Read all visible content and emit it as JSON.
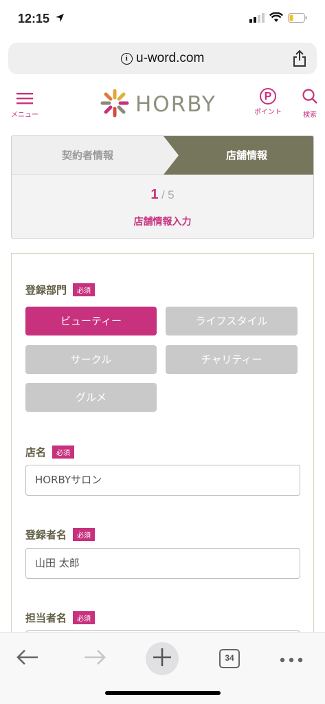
{
  "status": {
    "time": "12:15"
  },
  "browser": {
    "url": "u-word.com",
    "tab_count": "34"
  },
  "header": {
    "menu_label": "メニュー",
    "logo_text": "HORBY",
    "point_letter": "P",
    "point_label": "ポイント",
    "search_label": "検索"
  },
  "steps": {
    "tab1": "契約者情報",
    "tab2": "店舗情報",
    "current": "1",
    "separator": "/",
    "total": "5",
    "title": "店舗情報入力"
  },
  "form": {
    "required_badge": "必須",
    "category": {
      "label": "登録部門",
      "options": [
        "ビューティー",
        "ライフスタイル",
        "サークル",
        "チャリティー",
        "グルメ"
      ],
      "selected": "ビューティー"
    },
    "shop_name": {
      "label": "店名",
      "value": "HORBYサロン"
    },
    "registrant": {
      "label": "登録者名",
      "value": "山田 太郎"
    },
    "contact": {
      "label": "担当者名"
    }
  },
  "colors": {
    "accent": "#c7317d",
    "olive": "#76765d",
    "disabled": "#c9c9c9"
  }
}
